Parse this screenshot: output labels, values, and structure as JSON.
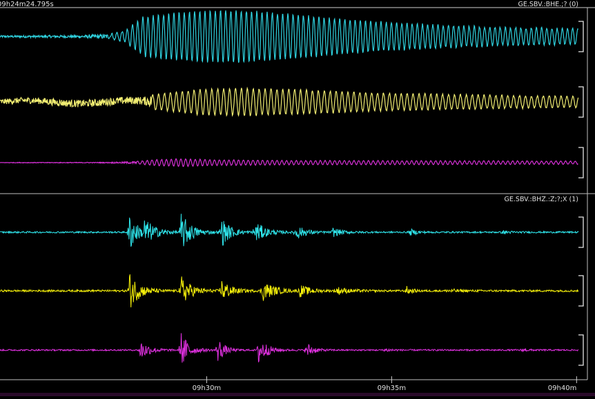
{
  "chart_data": {
    "type": "line",
    "start_time": "09h24m24.795s",
    "x_ticks": [
      "09h30m",
      "09h35m",
      "09h40m"
    ],
    "x_tick_minutes": [
      30,
      35,
      40
    ],
    "x_range_minutes": [
      24.413,
      40.05
    ],
    "panels": [
      {
        "label": "GE.SBV.:BHE.;? (0)",
        "series": [
          {
            "color": "#2fd3e0",
            "envelope": [
              [
                24.4,
                0.04
              ],
              [
                26.5,
                0.05
              ],
              [
                27.4,
                0.1
              ],
              [
                27.8,
                0.22
              ],
              [
                28.3,
                0.75
              ],
              [
                29.3,
                0.92
              ],
              [
                30.8,
                1.0
              ],
              [
                32.0,
                0.88
              ],
              [
                34.0,
                0.62
              ],
              [
                36.0,
                0.45
              ],
              [
                38.0,
                0.34
              ],
              [
                40.05,
                0.3
              ]
            ],
            "onset": 27.4,
            "period": 0.14
          },
          {
            "color": "#f2ee72",
            "envelope": [
              [
                24.4,
                0.15
              ],
              [
                26.0,
                0.2
              ],
              [
                28.3,
                0.22
              ],
              [
                28.6,
                0.42
              ],
              [
                29.8,
                0.7
              ],
              [
                31.0,
                0.76
              ],
              [
                32.5,
                0.68
              ],
              [
                34.5,
                0.5
              ],
              [
                36.5,
                0.42
              ],
              [
                38.5,
                0.34
              ],
              [
                40.05,
                0.3
              ]
            ],
            "onset": 28.5,
            "period": 0.16,
            "drift": 0.35
          },
          {
            "color": "#d630d6",
            "envelope": [
              [
                24.4,
                0.04
              ],
              [
                27.3,
                0.06
              ],
              [
                28.1,
                0.18
              ],
              [
                28.6,
                0.42
              ],
              [
                29.3,
                0.55
              ],
              [
                30.3,
                0.4
              ],
              [
                32.5,
                0.3
              ],
              [
                35.0,
                0.28
              ],
              [
                37.5,
                0.26
              ],
              [
                40.05,
                0.22
              ]
            ],
            "onset": 28.1,
            "period": 0.13
          }
        ]
      },
      {
        "label": "GE.SBV.:BHZ.:Z;?;X (1)",
        "series": [
          {
            "color": "#2fe6ec",
            "bursts": [
              [
                27.9,
                1.0,
                0.35
              ],
              [
                28.3,
                0.6,
                0.5
              ],
              [
                29.3,
                0.95,
                0.45
              ],
              [
                30.4,
                0.7,
                0.4
              ],
              [
                31.3,
                0.55,
                0.45
              ],
              [
                32.4,
                0.38,
                0.4
              ],
              [
                33.4,
                0.22,
                0.4
              ],
              [
                35.5,
                0.15,
                0.3
              ],
              [
                38.0,
                0.08,
                0.3
              ]
            ],
            "base": 0.04
          },
          {
            "color": "#f5f00a",
            "bursts": [
              [
                27.9,
                1.0,
                0.45
              ],
              [
                29.3,
                0.8,
                0.45
              ],
              [
                30.4,
                0.6,
                0.4
              ],
              [
                31.5,
                0.55,
                0.5
              ],
              [
                32.5,
                0.3,
                0.5
              ],
              [
                33.5,
                0.2,
                0.5
              ],
              [
                35.4,
                0.22,
                0.25
              ],
              [
                36.5,
                0.1,
                0.5
              ]
            ],
            "base": 0.05
          },
          {
            "color": "#e431e4",
            "bursts": [
              [
                28.2,
                0.55,
                0.4
              ],
              [
                29.3,
                1.0,
                0.35
              ],
              [
                30.3,
                0.65,
                0.3
              ],
              [
                31.4,
                0.85,
                0.35
              ],
              [
                32.7,
                0.45,
                0.3
              ],
              [
                34.8,
                0.1,
                0.3
              ],
              [
                38.5,
                0.08,
                0.3
              ]
            ],
            "base": 0.04
          }
        ]
      }
    ]
  }
}
